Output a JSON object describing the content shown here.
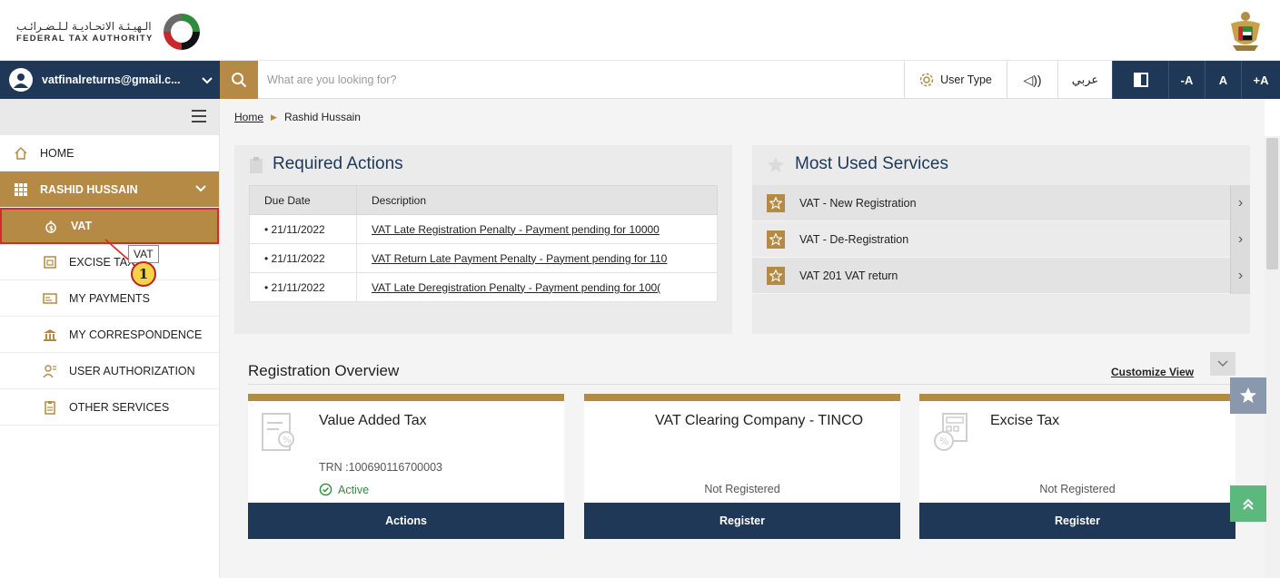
{
  "header": {
    "logo_arabic": "الـهيـئـة الاتحـاديـة لـلـضـرائـب",
    "logo_english": "FEDERAL TAX AUTHORITY"
  },
  "navbar": {
    "user_email": "vatfinalreturns@gmail.c...",
    "search_placeholder": "What are you looking for?",
    "user_type_label": "User Type",
    "audio_label": "◁))",
    "arabic_label": "عربي",
    "font_decrease": "-A",
    "font_normal": "A",
    "font_increase": "+A"
  },
  "sidebar": {
    "items": [
      {
        "label": "HOME",
        "icon": "home-icon"
      },
      {
        "label": "RASHID HUSSAIN",
        "icon": "grid-icon"
      },
      {
        "label": "VAT",
        "icon": "money-bag-icon"
      },
      {
        "label": "EXCISE TAX",
        "icon": "excise-icon"
      },
      {
        "label": "MY PAYMENTS",
        "icon": "payments-icon"
      },
      {
        "label": "MY CORRESPONDENCE",
        "icon": "bank-icon"
      },
      {
        "label": "USER AUTHORIZATION",
        "icon": "user-auth-icon"
      },
      {
        "label": "OTHER SERVICES",
        "icon": "clipboard-icon"
      }
    ],
    "tooltip": "VAT",
    "callout_number": "1"
  },
  "breadcrumb": {
    "home": "Home",
    "current": "Rashid Hussain"
  },
  "required_actions": {
    "title": "Required Actions",
    "columns": [
      "Due Date",
      "Description"
    ],
    "rows": [
      {
        "date": "• 21/11/2022",
        "desc": "VAT Late Registration Penalty - Payment pending for 10000"
      },
      {
        "date": "• 21/11/2022",
        "desc": "VAT Return Late Payment Penalty - Payment pending for 110"
      },
      {
        "date": "• 21/11/2022",
        "desc": "VAT Late Deregistration Penalty - Payment pending for 100("
      }
    ]
  },
  "most_used": {
    "title": "Most Used Services",
    "items": [
      "VAT - New Registration",
      "VAT - De-Registration",
      "VAT 201 VAT return"
    ]
  },
  "registration": {
    "title": "Registration Overview",
    "customize": "Customize View",
    "cards": [
      {
        "title": "Value Added Tax",
        "trn": "TRN :100690116700003",
        "status": "Active",
        "button": "Actions"
      },
      {
        "title": "VAT Clearing Company - TINCO",
        "status": "Not Registered",
        "button": "Register"
      },
      {
        "title": "Excise Tax",
        "status": "Not Registered",
        "button": "Register"
      }
    ]
  },
  "colors": {
    "navy": "#1f3857",
    "gold": "#b48a44",
    "highlight_border": "#d42b2b",
    "active_green": "#2e8b3e"
  }
}
